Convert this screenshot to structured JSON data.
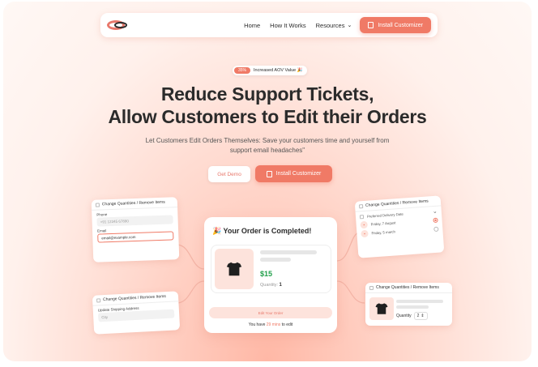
{
  "nav": {
    "links": [
      "Home",
      "How It Works",
      "Resources"
    ],
    "install_label": "Install Customizer"
  },
  "badge": {
    "percent": "35%",
    "text": "Increased AOV Value 🎉"
  },
  "hero": {
    "title_line1": "Reduce Support Tickets,",
    "title_line2": "Allow Customers to Edit their Orders",
    "subtitle": "Let Customers Edit Orders Themselves: Save your customers time and yourself from support email headaches\"",
    "demo_label": "Get Demo",
    "install_label": "Install Customizer"
  },
  "card_left_top": {
    "header": "Change Quantities / Remove Items",
    "phone_label": "Phone",
    "phone_value": "+91 12345 67890",
    "email_label": "Email",
    "email_value": "email@example.com"
  },
  "card_left_bottom": {
    "header": "Change Quantities / Remove Items",
    "address_label": "Update Shipping Address",
    "city_placeholder": "City"
  },
  "main_card": {
    "title": "🎉 Your Order is Completed!",
    "price": "$15",
    "qty_label": "Quantity",
    "qty_value": "1",
    "edit_label": "Edit Your Order",
    "note_prefix": "You have",
    "note_accent": "29 mins",
    "note_suffix": "to edit"
  },
  "card_right_top": {
    "header": "Change Quantities / Remove Items",
    "option_title": "Preferred Delivery Date",
    "opt1_line1": "Friday, 7 August",
    "opt2_line1": "Friday, 5 march"
  },
  "card_right_bottom": {
    "header": "Change Quantities / Remove Items",
    "qty_label": "Quantity",
    "qty_value": "2"
  },
  "colors": {
    "accent": "#f07a66",
    "price": "#22a04b",
    "dark": "#2b2b2b"
  }
}
